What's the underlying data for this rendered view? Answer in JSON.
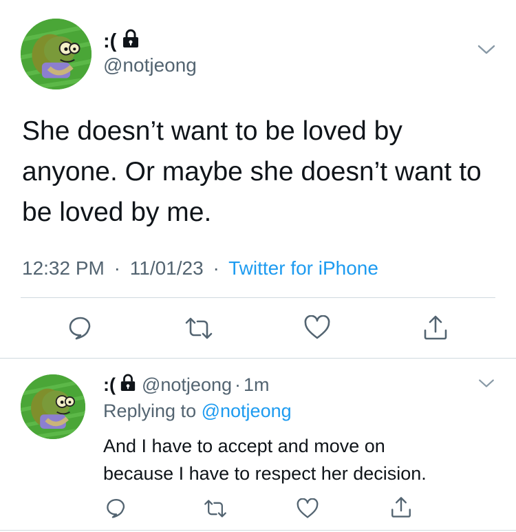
{
  "main_tweet": {
    "display_name": ":(",
    "handle": "@notjeong",
    "text_line1": "She doesn’t want to be loved by",
    "text_line2": "anyone. Or maybe she doesn’t want to",
    "text_line3": "be loved by me.",
    "time": "12:32 PM",
    "date": "11/01/23",
    "source": "Twitter for iPhone",
    "sep": "·",
    "avatar_icon": "fish-character-avatar",
    "lock_icon": "lock-icon"
  },
  "reply_tweet": {
    "display_name": ":(",
    "handle": "@notjeong",
    "age": "1m",
    "sep": "·",
    "replying_prefix": "Replying to",
    "replying_to": "@notjeong",
    "text_line1": "And I have to accept and move on",
    "text_line2": "because I have to respect her decision."
  },
  "colors": {
    "text": "#0f1419",
    "muted": "#536471",
    "link": "#1d9bf0",
    "divider": "#cfd9de"
  }
}
